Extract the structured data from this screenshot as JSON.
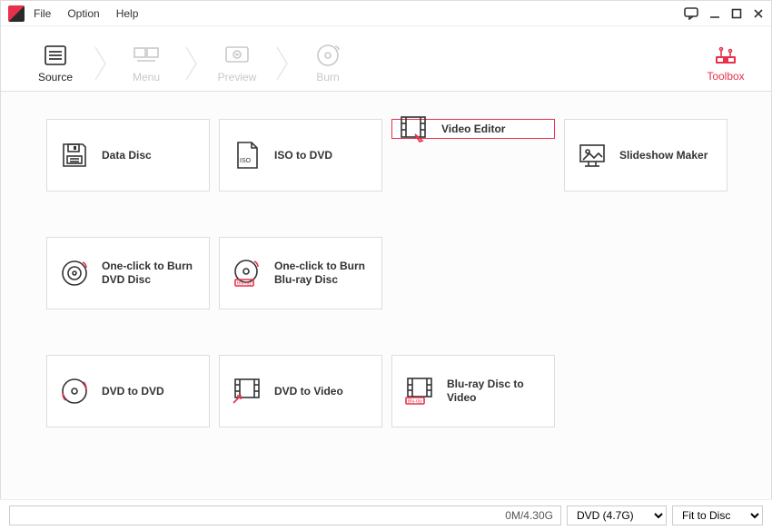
{
  "menu": {
    "file": "File",
    "option": "Option",
    "help": "Help"
  },
  "steps": {
    "source": "Source",
    "menu": "Menu",
    "preview": "Preview",
    "burn": "Burn"
  },
  "toolbox": {
    "label": "Toolbox"
  },
  "cards": {
    "data_disc": "Data Disc",
    "iso_to_dvd": "ISO to DVD",
    "video_editor": "Video Editor",
    "slideshow_maker": "Slideshow Maker",
    "one_click_dvd": "One-click to Burn DVD Disc",
    "one_click_bluray": "One-click to Burn Blu-ray Disc",
    "dvd_to_dvd": "DVD to DVD",
    "dvd_to_video": "DVD to Video",
    "bluray_to_video": "Blu-ray Disc to Video"
  },
  "status": {
    "progress": "0M/4.30G",
    "disc_type": "DVD (4.7G)",
    "fit": "Fit to Disc"
  }
}
